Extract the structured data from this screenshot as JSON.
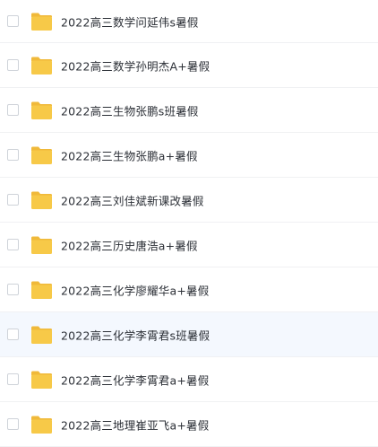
{
  "file_list": {
    "items": [
      {
        "name": "2022高三数学问延伟s暑假",
        "selected": false,
        "highlighted": false,
        "icon": "folder-icon"
      },
      {
        "name": "2022高三数学孙明杰A+暑假",
        "selected": false,
        "highlighted": false,
        "icon": "folder-icon"
      },
      {
        "name": "2022高三生物张鹏s班暑假",
        "selected": false,
        "highlighted": false,
        "icon": "folder-icon"
      },
      {
        "name": "2022高三生物张鹏a+暑假",
        "selected": false,
        "highlighted": false,
        "icon": "folder-icon"
      },
      {
        "name": "2022高三刘佳斌新课改暑假",
        "selected": false,
        "highlighted": false,
        "icon": "folder-icon"
      },
      {
        "name": "2022高三历史唐浩a+暑假",
        "selected": false,
        "highlighted": false,
        "icon": "folder-icon"
      },
      {
        "name": "2022高三化学廖耀华a+暑假",
        "selected": false,
        "highlighted": false,
        "icon": "folder-icon"
      },
      {
        "name": "2022高三化学李霄君s班暑假",
        "selected": false,
        "highlighted": true,
        "icon": "folder-icon"
      },
      {
        "name": "2022高三化学李霄君a+暑假",
        "selected": false,
        "highlighted": false,
        "icon": "folder-icon"
      },
      {
        "name": "2022高三地理崔亚飞a+暑假",
        "selected": false,
        "highlighted": false,
        "icon": "folder-icon"
      }
    ]
  },
  "colors": {
    "folder_body": "#f7c948",
    "folder_tab": "#f0b93a",
    "row_highlight": "#f4f8fe",
    "text": "#2b2f36",
    "checkbox_border": "#cfd3d9"
  }
}
